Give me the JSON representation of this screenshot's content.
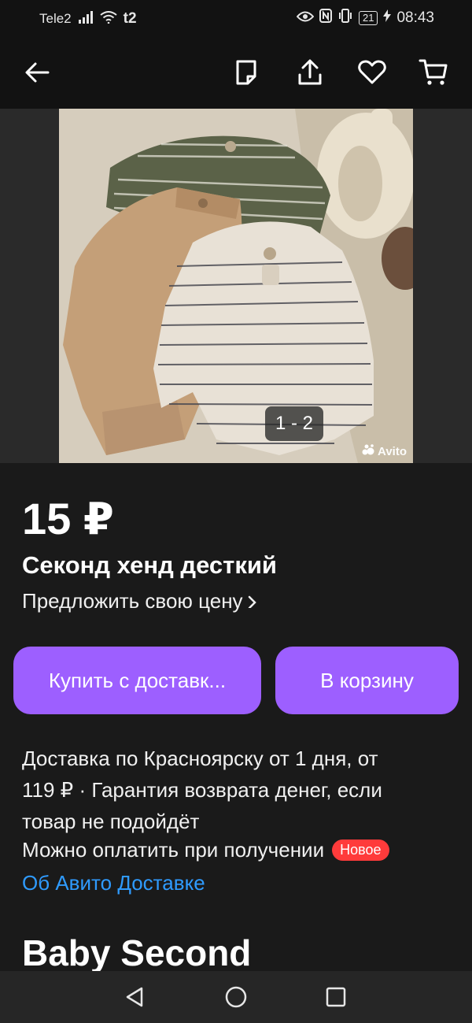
{
  "status_bar": {
    "carrier": "Tele2",
    "carrier2": "t2",
    "battery": "21",
    "time": "08:43"
  },
  "topbar": {
    "icons": [
      "back-arrow-icon",
      "note-icon",
      "share-icon",
      "heart-icon",
      "cart-icon"
    ]
  },
  "gallery": {
    "counter": "1 - 2",
    "watermark": "Avito"
  },
  "listing": {
    "price": "15 ₽",
    "title": "Секонд хенд десткий",
    "offer_label": "Предложить свою цену"
  },
  "actions": {
    "buy_label": "Купить с доставк...",
    "cart_label": "В корзину",
    "accent_color": "#9d5fff"
  },
  "delivery": {
    "line1": "Доставка по Красноярску от 1 дня, от",
    "line2": "119 ₽ · Гарантия возврата денег, если",
    "line3": "товар не подойдёт",
    "pay_on_receipt": "Можно оплатить при получении",
    "new_badge": "Новое",
    "link": "Об Авито Доставке"
  },
  "seller": {
    "name": "Baby Second"
  }
}
